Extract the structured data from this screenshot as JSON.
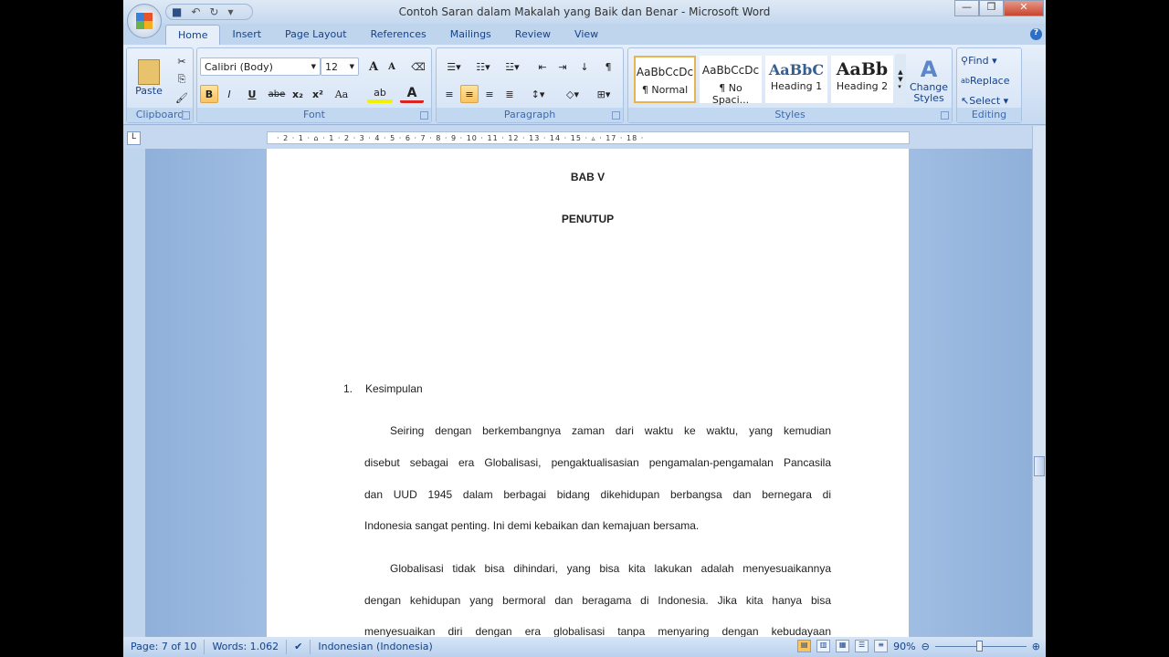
{
  "window": {
    "title": "Contoh Saran dalam Makalah yang Baik dan Benar - Microsoft Word"
  },
  "tabs": [
    "Home",
    "Insert",
    "Page Layout",
    "References",
    "Mailings",
    "Review",
    "View"
  ],
  "ribbon": {
    "clipboard": {
      "label": "Clipboard",
      "paste": "Paste"
    },
    "font": {
      "label": "Font",
      "family": "Calibri (Body)",
      "size": "12",
      "bold": "B",
      "italic": "I",
      "underline": "U",
      "strike": "abe",
      "sub": "x₂",
      "sup": "x²",
      "case": "Aa",
      "grow": "A",
      "shrink": "A",
      "color_letter": "A"
    },
    "paragraph": {
      "label": "Paragraph"
    },
    "styles": {
      "label": "Styles",
      "items": [
        {
          "sample": "AaBbCcDc",
          "name": "¶ Normal"
        },
        {
          "sample": "AaBbCcDc",
          "name": "¶ No Spaci..."
        },
        {
          "sample": "AaBbC",
          "name": "Heading 1"
        },
        {
          "sample": "AaBb",
          "name": "Heading 2"
        }
      ],
      "change": "Change Styles"
    },
    "editing": {
      "label": "Editing",
      "find": "Find",
      "replace": "Replace",
      "select": "Select"
    }
  },
  "ruler": "· 2 · 1 · ⌂ · 1 · 2 · 3 · 4 · 5 · 6 · 7 · 8 · 9 · 10 · 11 · 12 · 13 · 14 · 15 · ▵ · 17 · 18 ·",
  "document": {
    "chapter": "BAB V",
    "heading": "PENUTUP",
    "list_num": "1.",
    "list_item": "Kesimpulan",
    "p1": [
      "Seiring dengan berkembangnya zaman dari waktu ke waktu, yang kemudian",
      "disebut sebagai era Globalisasi, pengaktualisasian pengamalan-pengamalan Pancasila",
      "dan UUD 1945 dalam berbagai bidang dikehidupan berbangsa dan bernegara di",
      "Indonesia sangat penting. Ini demi kebaikan dan kemajuan bersama."
    ],
    "p2": [
      "Globalisasi tidak bisa dihindari, yang bisa kita lakukan adalah menyesuaikannya",
      "dengan kehidupan yang bermoral dan beragama di Indonesia. Jika kita hanya bisa",
      "menyesuaikan diri dengan era globalisasi tanpa menyaring dengan kebudayaan"
    ]
  },
  "status": {
    "page": "Page: 7 of 10",
    "words": "Words: 1.062",
    "language": "Indonesian (Indonesia)",
    "zoom": "90%"
  },
  "colors": {
    "accent": "#15428b",
    "highlight": "#f9c360"
  }
}
